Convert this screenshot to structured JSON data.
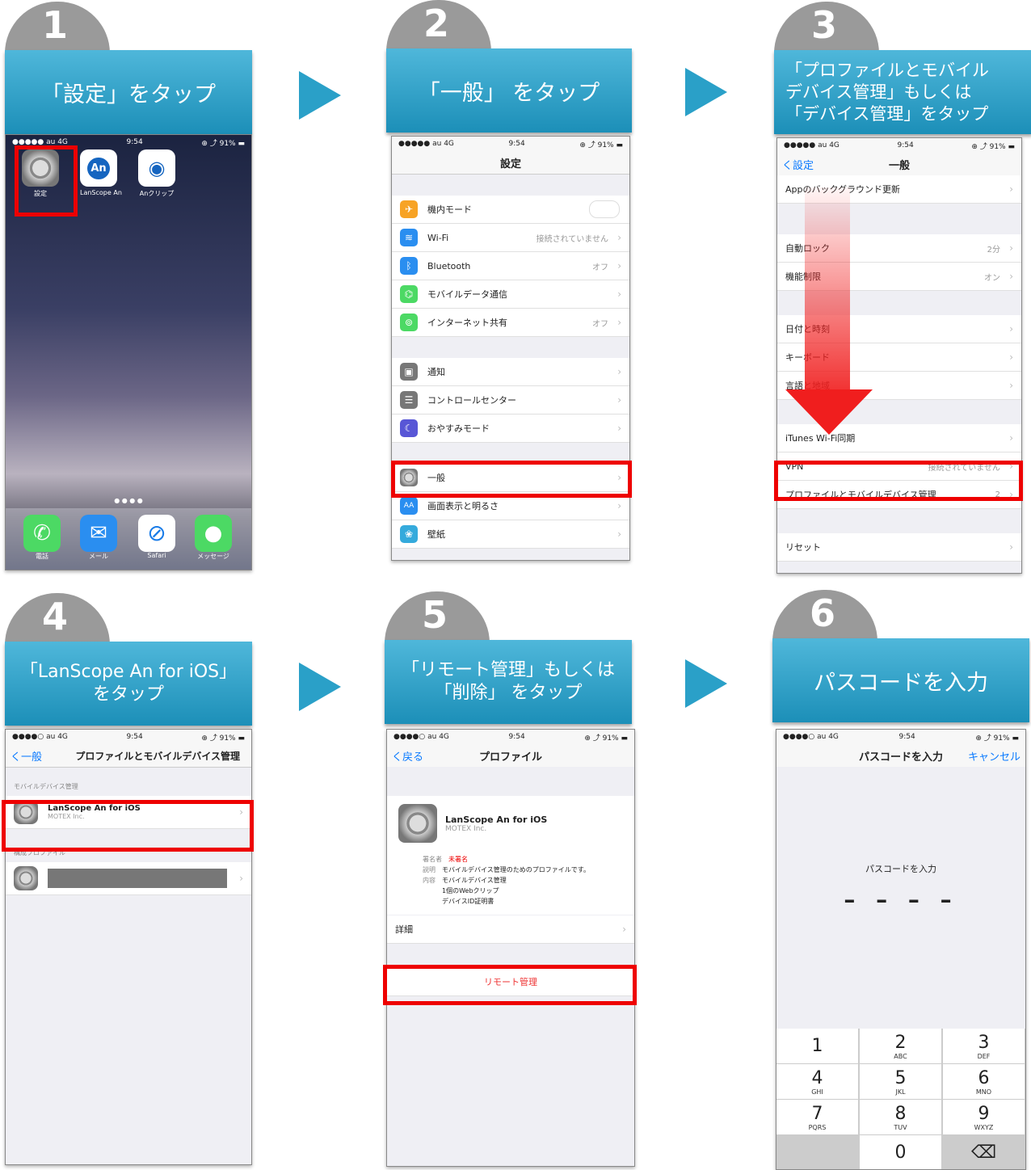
{
  "steps": [
    {
      "num": "1",
      "title": "「設定」をタップ"
    },
    {
      "num": "2",
      "title": "「一般」 をタップ"
    },
    {
      "num": "3",
      "title": "「プロファイルとモバイルデバイス管理」もしくは「デバイス管理」をタップ",
      "line1": "「プロファイルとモバイル",
      "line2": "デバイス管理」もしくは",
      "line3": "「デバイス管理」をタップ"
    },
    {
      "num": "4",
      "title": "「LanScope An for iOS」をタップ",
      "line1": "「LanScope An for iOS」",
      "line2": "をタップ"
    },
    {
      "num": "5",
      "title": "「リモート管理」もしくは「削除」 をタップ",
      "line1": "「リモート管理」もしくは",
      "line2": "「削除」 をタップ"
    },
    {
      "num": "6",
      "title": "パスコードを入力"
    }
  ],
  "status": {
    "carrier": "●●●●● au 4G",
    "carrier2": "●●●●○ au 4G",
    "time": "9:54",
    "battery": "⊕ ⤴ 91% ▬"
  },
  "home": {
    "apps": [
      "設定",
      "LanScope An",
      "Anクリップ"
    ],
    "dock": [
      "電話",
      "メール",
      "Safari",
      "メッセージ"
    ],
    "an_label": "An"
  },
  "settings": {
    "title": "設定",
    "rows": [
      {
        "label": "機内モード",
        "value": ""
      },
      {
        "label": "Wi-Fi",
        "value": "接続されていません"
      },
      {
        "label": "Bluetooth",
        "value": "オフ"
      },
      {
        "label": "モバイルデータ通信",
        "value": ""
      },
      {
        "label": "インターネット共有",
        "value": "オフ"
      },
      {
        "label": "通知",
        "value": ""
      },
      {
        "label": "コントロールセンター",
        "value": ""
      },
      {
        "label": "おやすみモード",
        "value": ""
      },
      {
        "label": "一般",
        "value": ""
      },
      {
        "label": "画面表示と明るさ",
        "value": ""
      },
      {
        "label": "壁紙",
        "value": ""
      }
    ]
  },
  "general": {
    "back": "く設定",
    "title": "一般",
    "rows": [
      {
        "label": "Appのバックグラウンド更新",
        "value": ""
      },
      {
        "label": "自動ロック",
        "value": "2分"
      },
      {
        "label": "機能制限",
        "value": "オン"
      },
      {
        "label": "日付と時刻",
        "value": ""
      },
      {
        "label": "キーボード",
        "value": ""
      },
      {
        "label": "言語と地域",
        "value": ""
      },
      {
        "label": "iTunes Wi-Fi同期",
        "value": ""
      },
      {
        "label": "VPN",
        "value": "接続されていません"
      },
      {
        "label": "プロファイルとモバイルデバイス管理",
        "value": "2"
      },
      {
        "label": "リセット",
        "value": ""
      }
    ]
  },
  "profiles": {
    "back": "く一般",
    "title": "プロファイルとモバイルデバイス管理",
    "section1": "モバイルデバイス管理",
    "name": "LanScope An for iOS",
    "org": "MOTEX Inc.",
    "section2": "構成プロファイル"
  },
  "profile": {
    "back": "く戻る",
    "title": "プロファイル",
    "name": "LanScope An for iOS",
    "org": "MOTEX Inc.",
    "signer_label": "署名者",
    "signer": "未署名",
    "desc_label": "説明",
    "desc": "モバイルデバイス管理のためのプロファイルです。",
    "content_label": "内容",
    "content1": "モバイルデバイス管理",
    "content2": "1個のWebクリップ",
    "content3": "デバイスID証明書",
    "details": "詳細",
    "remote": "リモート管理"
  },
  "passcode": {
    "title": "パスコードを入力",
    "cancel": "キャンセル",
    "prompt": "パスコードを入力",
    "dashes": "– – – –",
    "keys": [
      {
        "n": "1",
        "l": ""
      },
      {
        "n": "2",
        "l": "ABC"
      },
      {
        "n": "3",
        "l": "DEF"
      },
      {
        "n": "4",
        "l": "GHI"
      },
      {
        "n": "5",
        "l": "JKL"
      },
      {
        "n": "6",
        "l": "MNO"
      },
      {
        "n": "7",
        "l": "PQRS"
      },
      {
        "n": "8",
        "l": "TUV"
      },
      {
        "n": "9",
        "l": "WXYZ"
      },
      {
        "n": "0",
        "l": ""
      }
    ],
    "delete": "⌫"
  }
}
